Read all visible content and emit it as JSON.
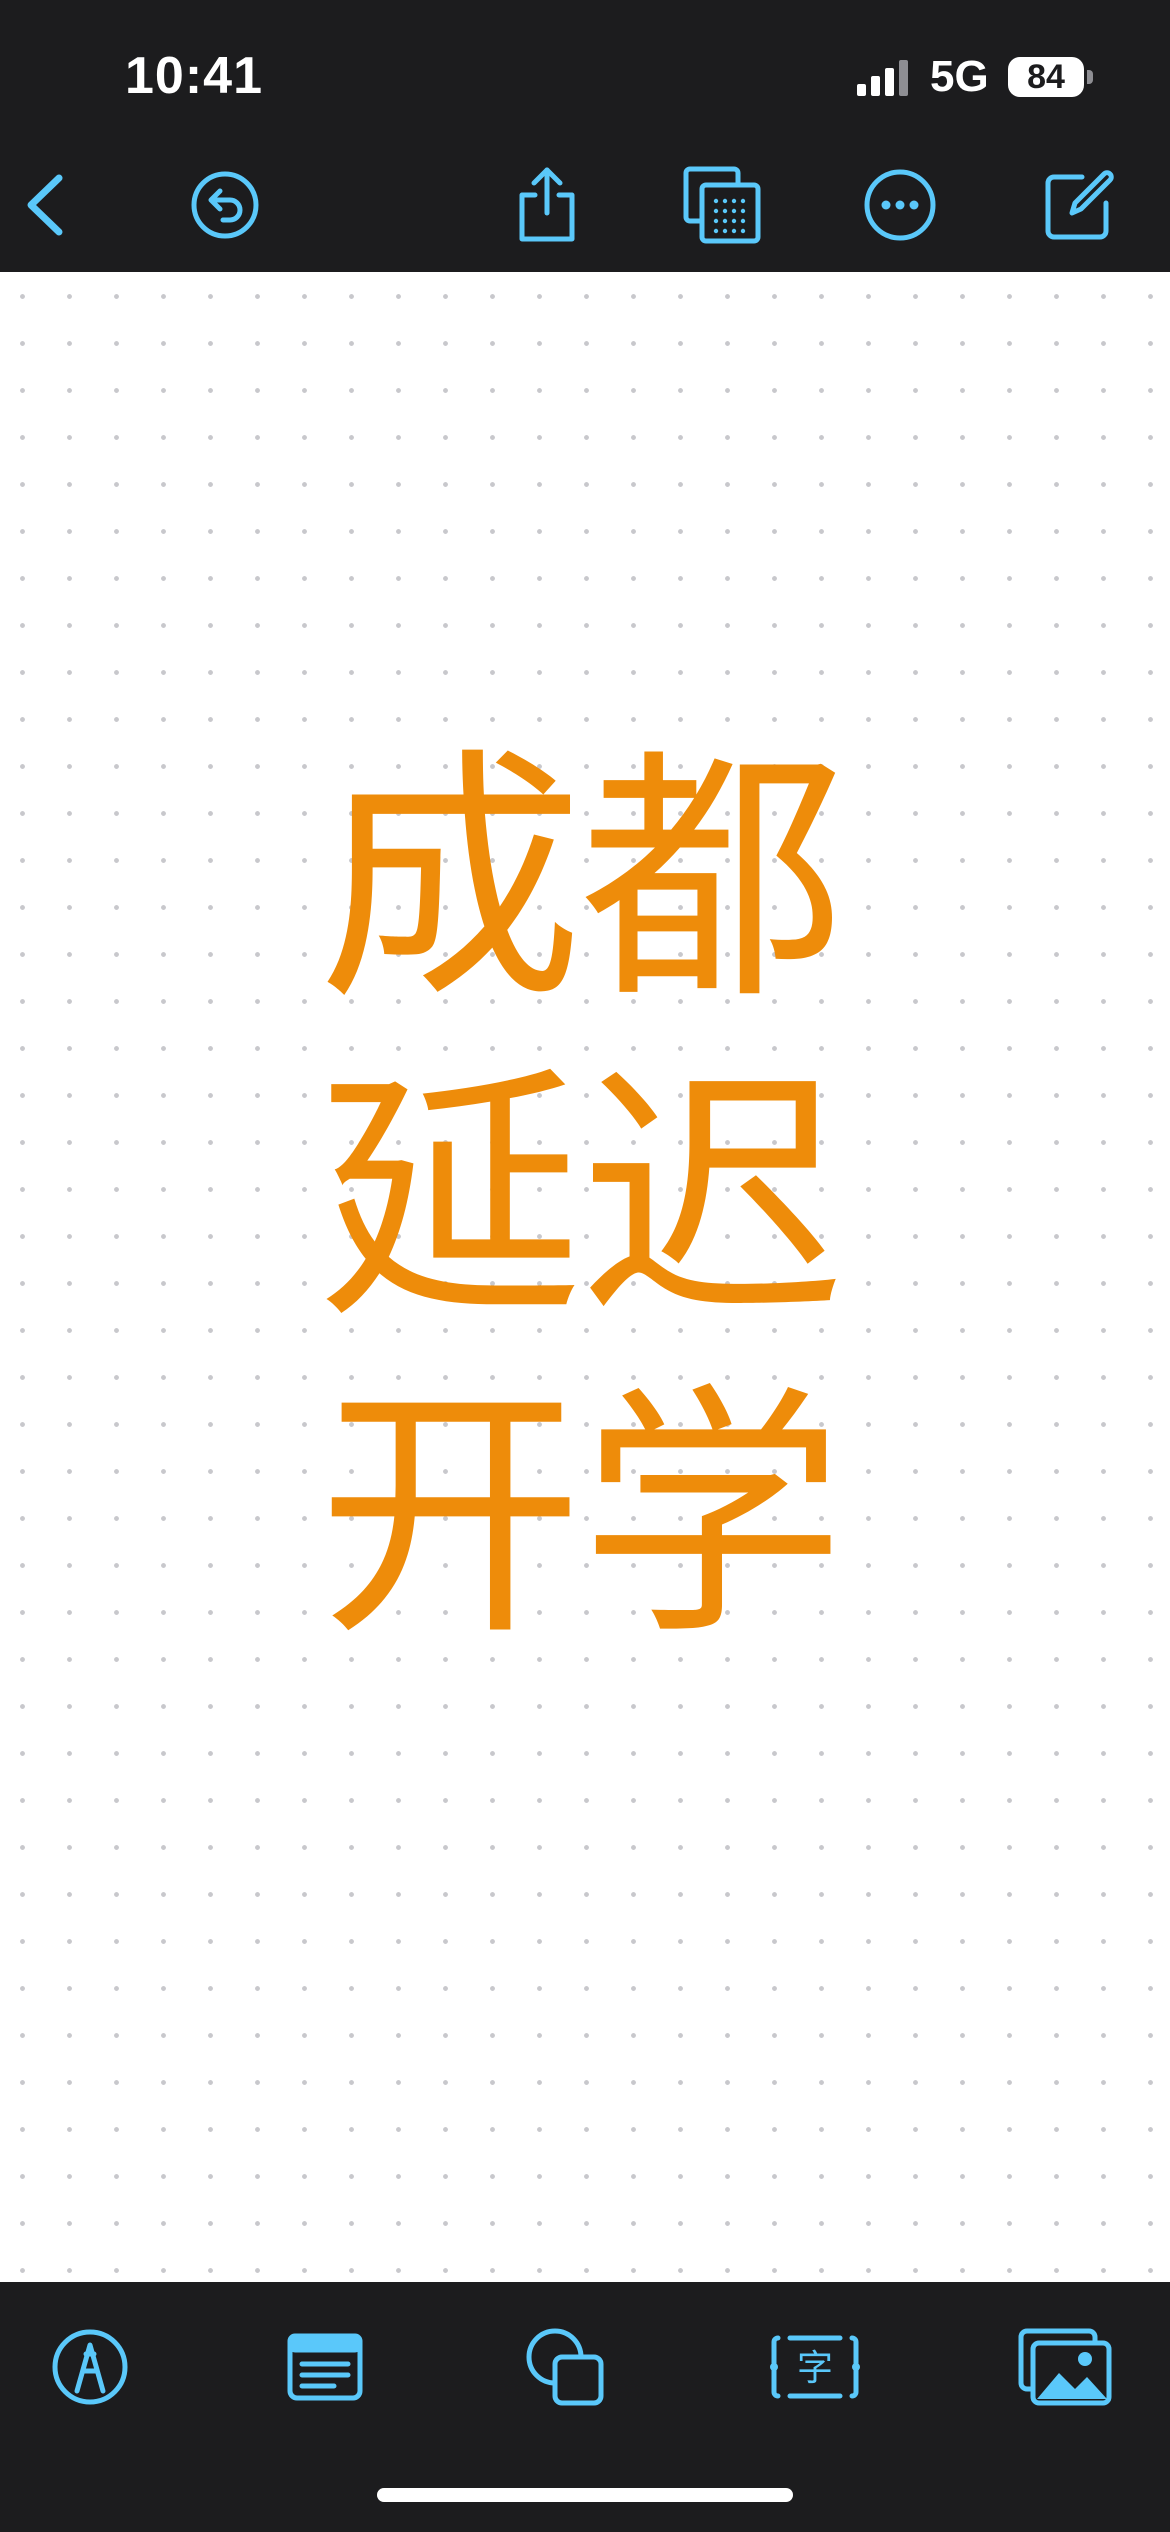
{
  "status": {
    "time": "10:41",
    "network": "5G",
    "battery": "84"
  },
  "toolbar": {
    "icons": [
      "back-icon",
      "undo-icon",
      "share-icon",
      "pages-icon",
      "more-icon",
      "compose-icon"
    ]
  },
  "note": {
    "lines": [
      "成都",
      "延迟",
      "开学"
    ],
    "text_color": "#ee8c0a"
  },
  "bottombar": {
    "icons": [
      "pen-icon",
      "text-box-icon",
      "shapes-icon",
      "text-icon",
      "media-icon"
    ],
    "text_icon_glyph": "字"
  },
  "colors": {
    "accent": "#5ac8fa",
    "chrome": "#1c1c1e",
    "canvas": "#ffffff",
    "grid_dot": "#c8c8cc"
  }
}
